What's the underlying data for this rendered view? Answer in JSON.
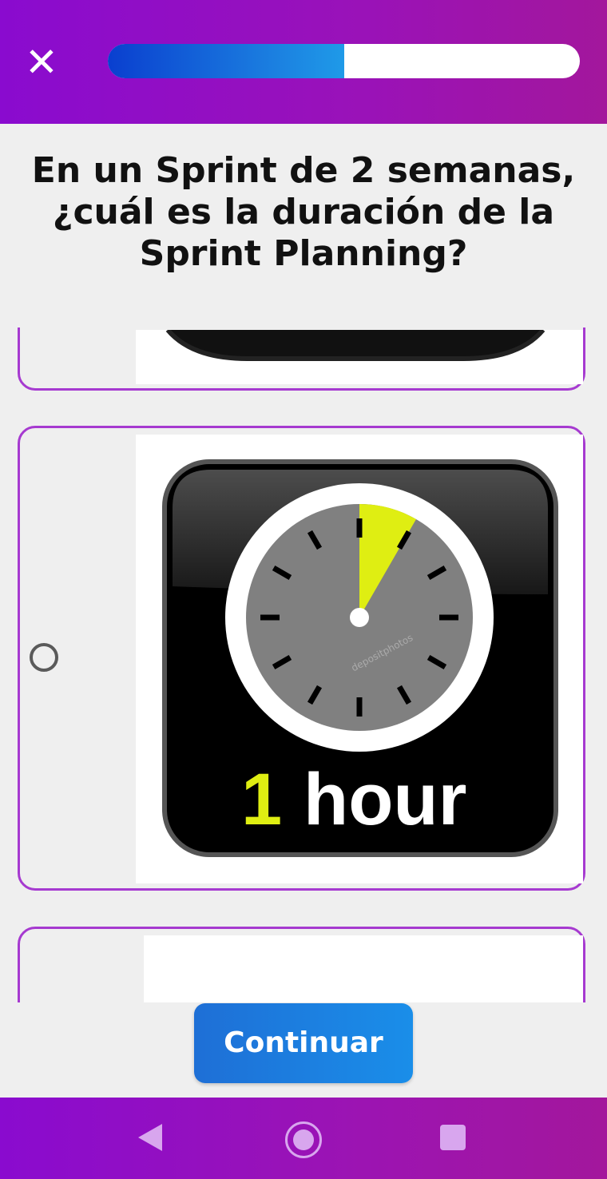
{
  "header": {
    "close_icon_glyph": "✕",
    "progress_fraction": 0.5
  },
  "question": {
    "text": "En un Sprint de 2 semanas, ¿cuál es la duración de la Sprint Planning?"
  },
  "options": [
    {
      "selected": false,
      "image": "timer-icon"
    },
    {
      "selected": false,
      "image": "one-hour-timer-icon",
      "image_text_number": "1",
      "image_text_unit": "hour",
      "watermark": "depositphotos"
    },
    {
      "selected": false,
      "image": "blank-image"
    }
  ],
  "footer": {
    "continue_label": "Continuar"
  },
  "navigation": {
    "buttons": [
      "back-icon",
      "home-icon",
      "recents-icon"
    ]
  },
  "colors": {
    "brand_purple": "#9a12b8",
    "card_border": "#a63ad0",
    "button_blue": "#1a8ee9",
    "timer_yellow": "#dfee12"
  }
}
